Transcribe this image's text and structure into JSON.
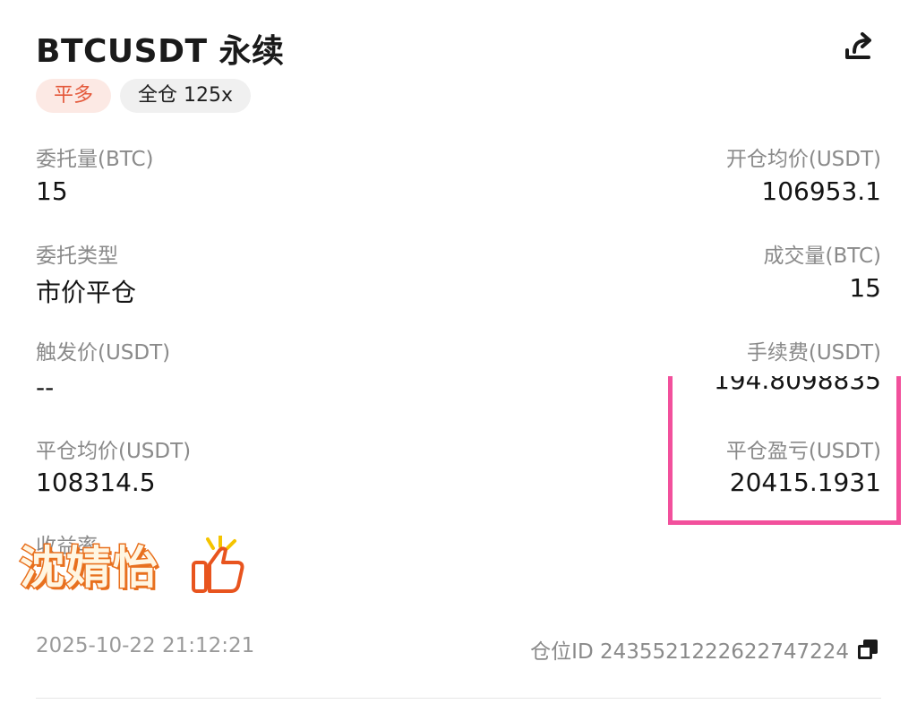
{
  "header": {
    "title": "BTCUSDT 永续",
    "share_icon": "share-icon"
  },
  "tags": {
    "side": "平多",
    "mode": "全仓 125x"
  },
  "fields": {
    "order_qty_label": "委托量(BTC)",
    "order_qty_value": "15",
    "open_avg_label": "开仓均价(USDT)",
    "open_avg_value": "106953.1",
    "order_type_label": "委托类型",
    "order_type_value": "市价平仓",
    "filled_qty_label": "成交量(BTC)",
    "filled_qty_value": "15",
    "trigger_label": "触发价(USDT)",
    "trigger_value": "--",
    "fee_label": "手续费(USDT)",
    "fee_value": "194.8098835",
    "close_avg_label": "平仓均价(USDT)",
    "close_avg_value": "108314.5",
    "pnl_label": "平仓盈亏(USDT)",
    "pnl_value": "20415.1931",
    "roi_label": "收益率"
  },
  "sticker": {
    "text": "沈婧怡",
    "icon": "thumbs-up-icon"
  },
  "footer": {
    "timestamp": "2025-10-22 21:12:21",
    "position_id": "仓位ID 2435521222622747224",
    "copy_icon": "copy-icon"
  },
  "colors": {
    "side_tag_text": "#e45a3c",
    "side_tag_bg": "#fce9e4",
    "highlight_border": "#f2509c",
    "sticker_outline": "#e8701e"
  }
}
